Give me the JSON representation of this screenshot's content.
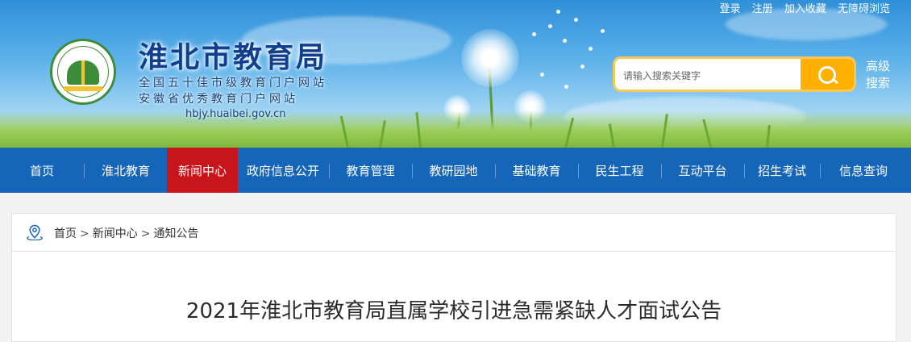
{
  "top_links": [
    "登录",
    "注册",
    "加入收藏",
    "无障碍浏览"
  ],
  "site": {
    "title": "淮北市教育局",
    "subtitle_1": "全国五十佳市级教育门户网站",
    "subtitle_2": "安徽省优秀教育门户网站",
    "domain": "hbjy.huaibei.gov.cn"
  },
  "search": {
    "placeholder": "请输入搜索关键字",
    "button_icon": "search-icon",
    "advanced_label": "高级搜索"
  },
  "nav": {
    "items": [
      {
        "label": "首页"
      },
      {
        "label": "淮北教育"
      },
      {
        "label": "新闻中心"
      },
      {
        "label": "政府信息公开"
      },
      {
        "label": "教育管理"
      },
      {
        "label": "教研园地"
      },
      {
        "label": "基础教育"
      },
      {
        "label": "民生工程"
      },
      {
        "label": "互动平台"
      },
      {
        "label": "招生考试"
      },
      {
        "label": "信息查询"
      }
    ],
    "active": "新闻中心"
  },
  "breadcrumb": {
    "icon": "location-pin-icon",
    "items": [
      "首页",
      "新闻中心",
      "通知公告"
    ],
    "separator": ">"
  },
  "article": {
    "title": "2021年淮北市教育局直属学校引进急需紧缺人才面试公告"
  },
  "colors": {
    "nav_bg": "#1565b8",
    "nav_active": "#c8141b",
    "search_button": "#ffb000",
    "title_blue": "#123f8c"
  }
}
